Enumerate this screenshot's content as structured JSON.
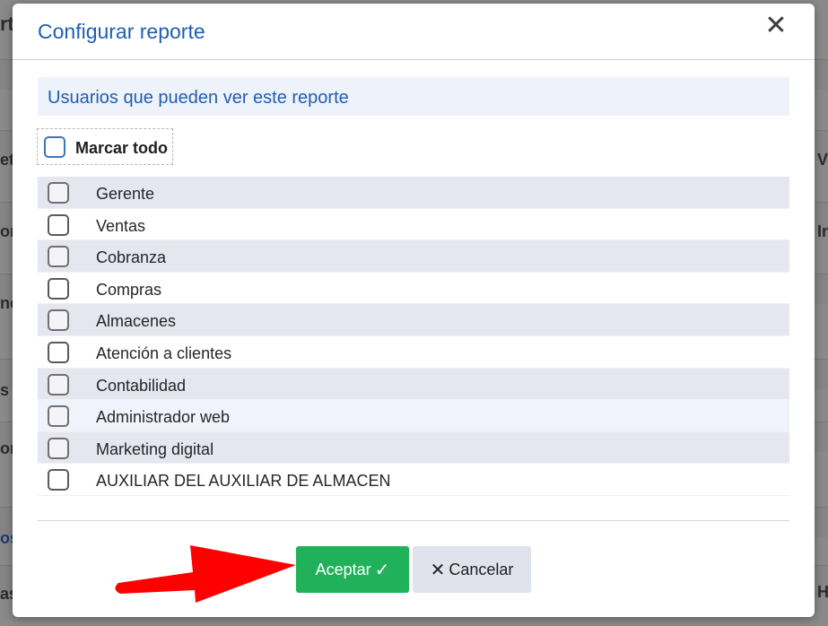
{
  "background": {
    "fragments": [
      "rt",
      "eta",
      "or",
      "nc",
      "s",
      "or",
      "os",
      "as",
      "V",
      "In",
      "H"
    ]
  },
  "modal": {
    "title": "Configurar reporte",
    "close_glyph": "✕",
    "section_title": "Usuarios que pueden ver este reporte",
    "select_all_label": "Marcar todo",
    "users": [
      {
        "label": "Gerente",
        "checked": false
      },
      {
        "label": "Ventas",
        "checked": false
      },
      {
        "label": "Cobranza",
        "checked": false
      },
      {
        "label": "Compras",
        "checked": false
      },
      {
        "label": "Almacenes",
        "checked": false
      },
      {
        "label": "Atención a clientes",
        "checked": false
      },
      {
        "label": "Contabilidad",
        "checked": false
      },
      {
        "label": "Administrador web",
        "checked": false
      },
      {
        "label": "Marketing digital",
        "checked": false
      },
      {
        "label": "AUXILIAR DEL AUXILIAR DE ALMACEN",
        "checked": false
      }
    ],
    "accept_label": "Aceptar",
    "accept_glyph": "✓",
    "cancel_label": "Cancelar",
    "cancel_glyph": "✕"
  },
  "colors": {
    "accent": "#1f5fb0",
    "accept": "#20b15a",
    "cancel": "#e1e3ec",
    "arrow": "#ff0000"
  },
  "icons": {
    "close": "close-icon",
    "check": "check-icon",
    "arrow": "red-arrow-icon"
  }
}
